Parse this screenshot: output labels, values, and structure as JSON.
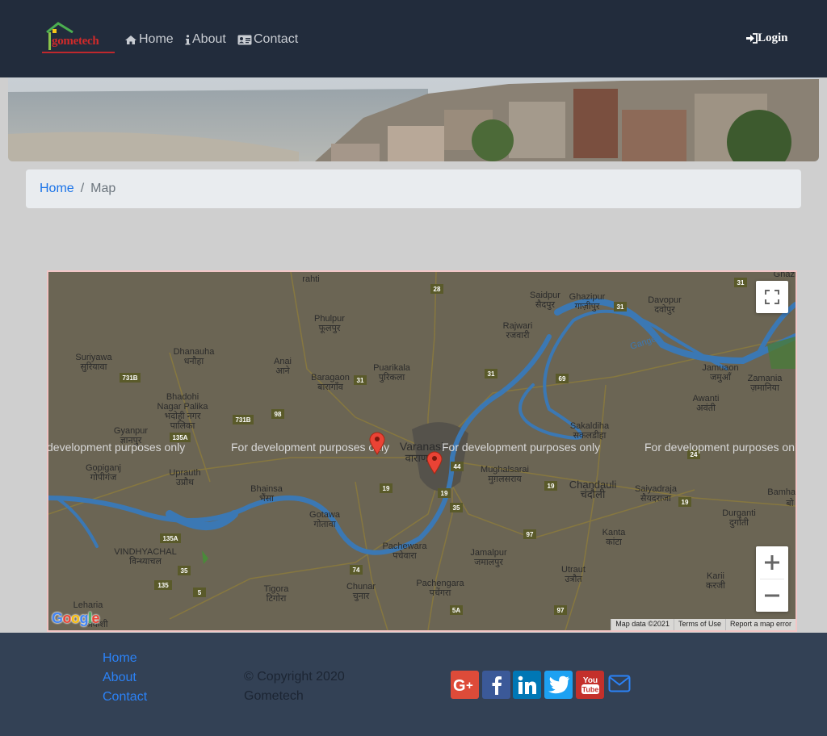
{
  "brand": {
    "logo_text": "gometech",
    "colors": {
      "navbar": "#222c3c",
      "footer": "#334155",
      "link": "#1a73e8"
    }
  },
  "nav": {
    "home": "Home",
    "about": "About",
    "contact": "Contact",
    "login": "Login"
  },
  "breadcrumb": {
    "home": "Home",
    "separator": "/",
    "current": "Map"
  },
  "map": {
    "watermark": "For development purposes only",
    "footer": {
      "data": "Map data ©2021",
      "terms": "Terms of Use",
      "report": "Report a map error"
    },
    "logo": "Google",
    "markers": 2,
    "places": [
      {
        "en": "Saidpur",
        "hi": "सैदपुर"
      },
      {
        "en": "Ghazipur",
        "hi": "गाज़ीपुर"
      },
      {
        "en": "Davopur",
        "hi": "दवोपुर"
      },
      {
        "en": "Phulpur",
        "hi": "फूलपुर"
      },
      {
        "en": "Rajwari",
        "hi": "रजवारी"
      },
      {
        "en": "Suriyawa",
        "hi": "सुरियावा"
      },
      {
        "en": "Dhanauha",
        "hi": "धनौहा"
      },
      {
        "en": "Anai",
        "hi": "आने"
      },
      {
        "en": "Puarikala",
        "hi": "पुरिकला"
      },
      {
        "en": "Baragaon",
        "hi": "बारागाँव"
      },
      {
        "en": "Jamuaon",
        "hi": "जमुआँ"
      },
      {
        "en": "Zamania",
        "hi": "ज़मानिया"
      },
      {
        "en": "Bhadohi Nagar Palika",
        "hi": "भदोही नगर पालिका"
      },
      {
        "en": "Awanti",
        "hi": "अवंती"
      },
      {
        "en": "Gyanpur",
        "hi": "ज्ञानपुर"
      },
      {
        "en": "Sakaldiha",
        "hi": "सकलडीहा"
      },
      {
        "en": "Varanasi",
        "hi": "वाराणसी"
      },
      {
        "en": "Gopiganj",
        "hi": "गोपीगंज"
      },
      {
        "en": "Uprauth",
        "hi": "उप्रौथ"
      },
      {
        "en": "Mughalsarai",
        "hi": "मुग़लसराय"
      },
      {
        "en": "Chandauli",
        "hi": "चंदौली"
      },
      {
        "en": "Saiyadraja",
        "hi": "सैयदराजा"
      },
      {
        "en": "Bhainsa",
        "hi": "भैंसा"
      },
      {
        "en": "Gotawa",
        "hi": "गोतावा"
      },
      {
        "en": "Durganti",
        "hi": "दुर्गांती"
      },
      {
        "en": "Bamhani",
        "hi": "बो"
      },
      {
        "en": "Kanta",
        "hi": "कांटा"
      },
      {
        "en": "VINDHYACHAL",
        "hi": "विन्ध्याचल"
      },
      {
        "en": "Pachewara",
        "hi": "पचेवारा"
      },
      {
        "en": "Jamalpur",
        "hi": "जमालपुर"
      },
      {
        "en": "Utraut",
        "hi": "उत्रौत"
      },
      {
        "en": "Karii",
        "hi": "करजी"
      },
      {
        "en": "Chunar",
        "hi": "चुनार"
      },
      {
        "en": "Pachengara",
        "hi": "पचेंगरा"
      },
      {
        "en": "Tigora",
        "hi": "टिगोरा"
      },
      {
        "en": "Leharia",
        "hi": "अकशी"
      },
      {
        "en": "Ganges",
        "hi": ""
      },
      {
        "en": "Ghazipur",
        "hi": ""
      },
      {
        "en": "rahti",
        "hi": "रहती"
      }
    ],
    "road_shields": [
      "28",
      "31",
      "31",
      "31",
      "31",
      "69",
      "731B",
      "98",
      "731B",
      "135A",
      "44",
      "19",
      "19",
      "19",
      "19",
      "24",
      "35",
      "97",
      "135A",
      "135",
      "35",
      "74",
      "5",
      "5A",
      "97"
    ]
  },
  "footer": {
    "links": [
      "Home",
      "About",
      "Contact"
    ],
    "copyright": "© Copyright 2020 Gometech",
    "social": [
      "google-plus",
      "facebook",
      "linkedin",
      "twitter",
      "youtube",
      "email"
    ]
  }
}
